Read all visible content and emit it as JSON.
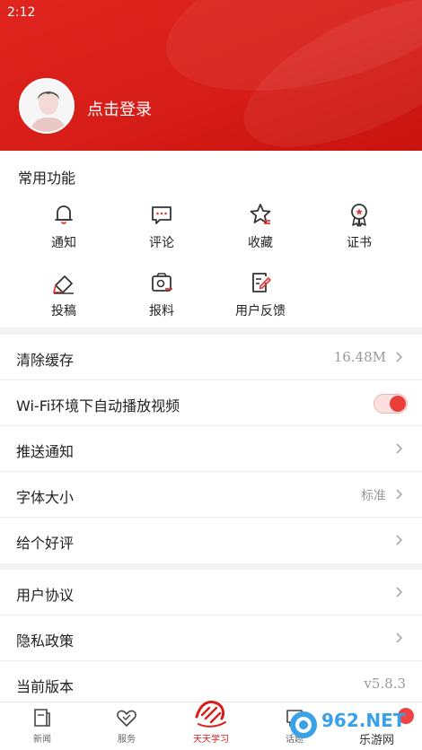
{
  "status_bar": {
    "time": "2:12"
  },
  "profile": {
    "login_label": "点击登录"
  },
  "common_functions": {
    "title": "常用功能",
    "items": [
      {
        "label": "通知",
        "icon": "bell-icon"
      },
      {
        "label": "评论",
        "icon": "comment-icon"
      },
      {
        "label": "收藏",
        "icon": "star-icon"
      },
      {
        "label": "证书",
        "icon": "certificate-icon"
      },
      {
        "label": "投稿",
        "icon": "pencil-icon"
      },
      {
        "label": "报料",
        "icon": "camera-icon"
      },
      {
        "label": "用户反馈",
        "icon": "feedback-icon"
      }
    ]
  },
  "settings": {
    "clear_cache": {
      "label": "清除缓存",
      "value": "16.48M"
    },
    "wifi_autoplay": {
      "label": "Wi-Fi环境下自动播放视频",
      "enabled": true
    },
    "push": {
      "label": "推送通知"
    },
    "font_size": {
      "label": "字体大小",
      "value": "标准"
    },
    "rate": {
      "label": "给个好评"
    }
  },
  "about": {
    "agreement": {
      "label": "用户协议"
    },
    "privacy": {
      "label": "隐私政策"
    },
    "version": {
      "label": "当前版本",
      "value": "v5.8.3"
    }
  },
  "bottom_nav": [
    {
      "label": "新闻",
      "icon": "news-icon"
    },
    {
      "label": "服务",
      "icon": "heart-icon"
    },
    {
      "label": "天天学习",
      "icon": "study-logo-icon"
    },
    {
      "label": "话题",
      "icon": "topic-icon"
    }
  ],
  "watermark": {
    "text": "962.NET",
    "subtext": "乐游网"
  },
  "colors": {
    "brand_red": "#d71d18",
    "toggle_on": "#ea3e3a"
  }
}
